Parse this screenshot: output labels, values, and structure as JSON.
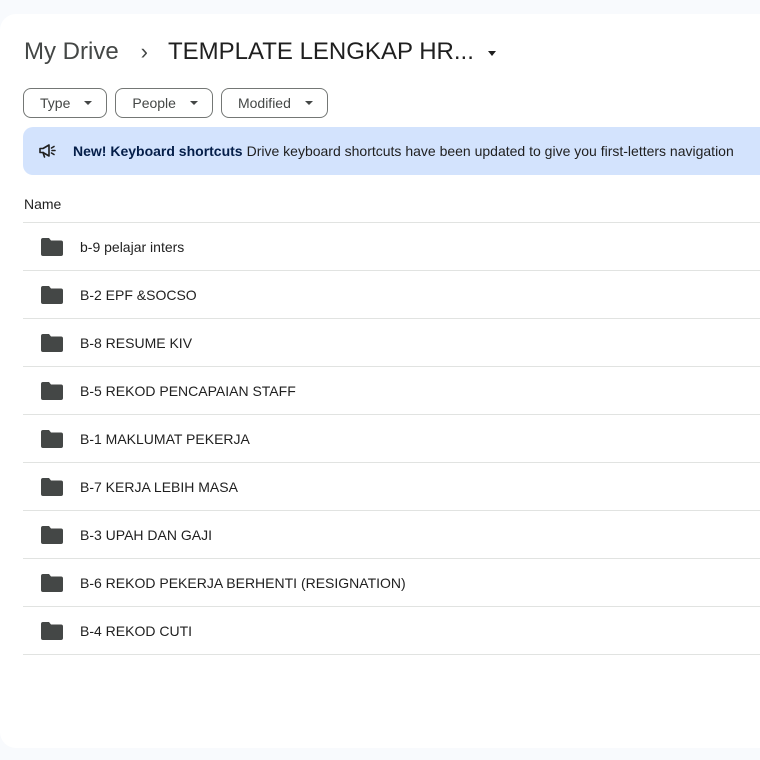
{
  "breadcrumb": {
    "root": "My Drive",
    "separator": "›",
    "current": "TEMPLATE LENGKAP HR..."
  },
  "filters": [
    {
      "label": "Type"
    },
    {
      "label": "People"
    },
    {
      "label": "Modified"
    }
  ],
  "banner": {
    "icon": "megaphone-icon",
    "title": "New! Keyboard shortcuts",
    "message": "Drive keyboard shortcuts have been updated to give you first-letters navigation"
  },
  "list": {
    "column_header": "Name",
    "items": [
      {
        "name": "b-9 pelajar inters",
        "icon": "folder-icon"
      },
      {
        "name": "B-2 EPF &SOCSO",
        "icon": "folder-icon"
      },
      {
        "name": "B-8 RESUME KIV",
        "icon": "folder-icon"
      },
      {
        "name": "B-5 REKOD PENCAPAIAN STAFF",
        "icon": "folder-icon"
      },
      {
        "name": "B-1 MAKLUMAT PEKERJA",
        "icon": "folder-icon"
      },
      {
        "name": "B-7 KERJA LEBIH MASA",
        "icon": "folder-icon"
      },
      {
        "name": "B-3 UPAH DAN GAJI",
        "icon": "folder-icon"
      },
      {
        "name": "B-6 REKOD PEKERJA BERHENTI (RESIGNATION)",
        "icon": "folder-icon"
      },
      {
        "name": "B-4 REKOD CUTI",
        "icon": "folder-icon"
      }
    ]
  },
  "colors": {
    "banner_bg": "#d3e3fd",
    "banner_title": "#041e49",
    "page_bg": "#f8fafd",
    "panel_bg": "#ffffff",
    "divider": "#e1e3e1",
    "folder": "#444746"
  }
}
